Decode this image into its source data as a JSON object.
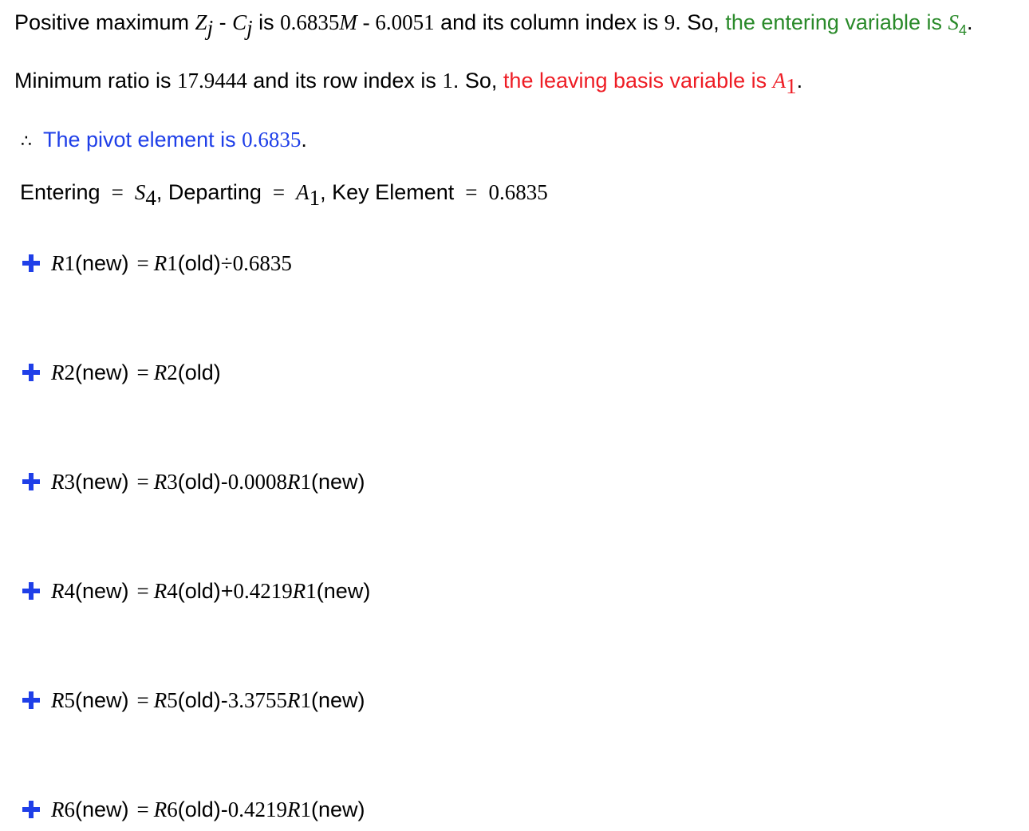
{
  "line1": {
    "prefix": "Positive maximum ",
    "z": "Z",
    "z_sub": "j",
    "minus": " - ",
    "c": "C",
    "c_sub": "j",
    "is": " is ",
    "value": "0.6835",
    "value_m": "M",
    "value_rest": " - 6.0051",
    "mid": " and its column index is ",
    "col_index": "9",
    "so": ". So, ",
    "highlight": "the entering variable is ",
    "var": "S",
    "var_sub": "4",
    "end": "."
  },
  "line2": {
    "prefix": "Minimum ratio is ",
    "ratio": "17.9444",
    "mid": " and its row index is ",
    "row_index": "1",
    "so": ". So, ",
    "highlight": "the leaving basis variable is ",
    "var": "A",
    "var_sub": "1",
    "end": "."
  },
  "line3": {
    "symbol": "∴",
    "text": "The pivot element is ",
    "value": "0.6835",
    "end": "."
  },
  "line4": {
    "entering_label": "Entering",
    "eq": "=",
    "entering_var": "S",
    "entering_sub": "4",
    "comma1": ",",
    "departing_label": " Departing",
    "departing_var": "A",
    "departing_sub": "1",
    "comma2": ",",
    "key_label": " Key Element",
    "key_value": "0.6835"
  },
  "rows": [
    {
      "r": "R",
      "sub": "1",
      "new": "(new)",
      "eq": "=",
      "r2": "R",
      "sub2": "1",
      "old": "(old)",
      "op": " ÷ ",
      "coef": "0.6835",
      "rr": "",
      "rr_sub": "",
      "rr_new": ""
    },
    {
      "r": "R",
      "sub": "2",
      "new": "(new)",
      "eq": "=",
      "r2": "R",
      "sub2": "2",
      "old": "(old)",
      "op": "",
      "coef": "",
      "rr": "",
      "rr_sub": "",
      "rr_new": ""
    },
    {
      "r": "R",
      "sub": "3",
      "new": "(new)",
      "eq": "=",
      "r2": "R",
      "sub2": "3",
      "old": "(old)",
      "op": " - ",
      "coef": "0.0008",
      "rr": "R",
      "rr_sub": "1",
      "rr_new": "(new)"
    },
    {
      "r": "R",
      "sub": "4",
      "new": "(new)",
      "eq": "=",
      "r2": "R",
      "sub2": "4",
      "old": "(old)",
      "op": " + ",
      "coef": "0.4219",
      "rr": "R",
      "rr_sub": "1",
      "rr_new": "(new)"
    },
    {
      "r": "R",
      "sub": "5",
      "new": "(new)",
      "eq": "=",
      "r2": "R",
      "sub2": "5",
      "old": "(old)",
      "op": " - ",
      "coef": "3.3755",
      "rr": "R",
      "rr_sub": "1",
      "rr_new": "(new)"
    },
    {
      "r": "R",
      "sub": "6",
      "new": "(new)",
      "eq": "=",
      "r2": "R",
      "sub2": "6",
      "old": "(old)",
      "op": " - ",
      "coef": "0.4219",
      "rr": "R",
      "rr_sub": "1",
      "rr_new": "(new)"
    }
  ],
  "colors": {
    "green": "#2a8a2a",
    "red": "#ee1c24",
    "blue": "#1f3fe8"
  },
  "icons": {
    "row_toggle": "plus-icon"
  }
}
